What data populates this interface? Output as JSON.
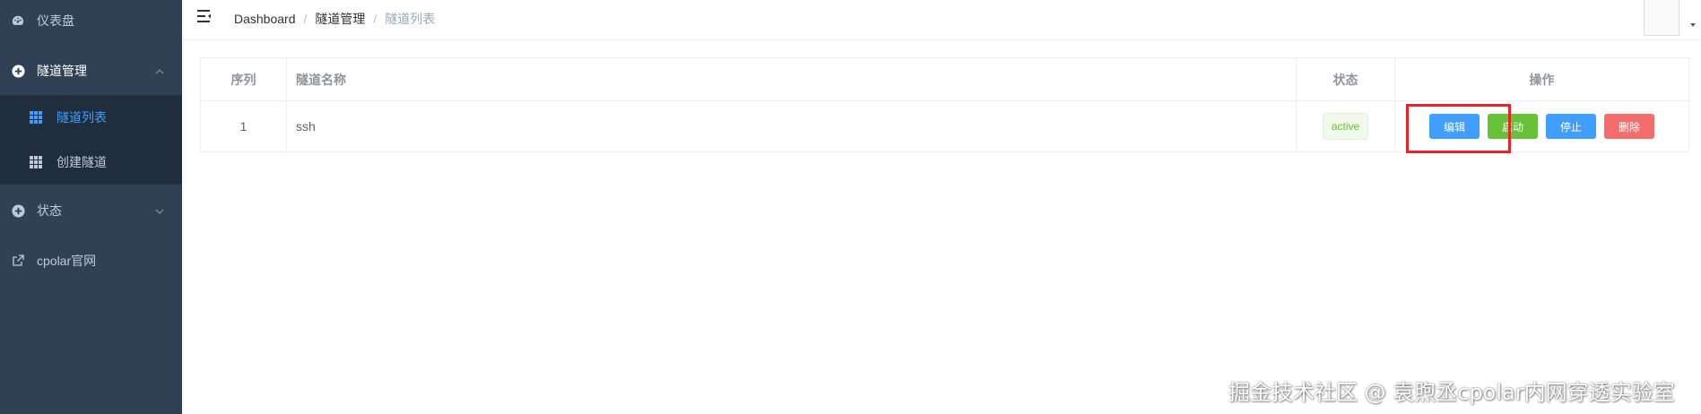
{
  "sidebar": {
    "dashboard_label": "仪表盘",
    "tunnel_mgmt_label": "隧道管理",
    "tunnel_list_label": "隧道列表",
    "create_tunnel_label": "创建隧道",
    "status_label": "状态",
    "website_label": "cpolar官网",
    "active_color": "#409eff"
  },
  "breadcrumb": {
    "items": [
      "Dashboard",
      "隧道管理",
      "隧道列表"
    ],
    "separator": "/"
  },
  "table": {
    "headers": [
      "序列",
      "隧道名称",
      "状态",
      "操作"
    ],
    "rows": [
      {
        "index": "1",
        "name": "ssh",
        "status": "active",
        "actions": [
          "编辑",
          "启动",
          "停止",
          "删除"
        ]
      }
    ]
  },
  "watermark": "掘金技术社区 @ 袁煦丞cpolar内网穿透实验室",
  "colors": {
    "sidebar_bg": "#304156",
    "submenu_bg": "#1f2d3d",
    "primary": "#409eff",
    "success": "#67c23a",
    "danger": "#f56c6c",
    "highlight": "#e8232a"
  }
}
